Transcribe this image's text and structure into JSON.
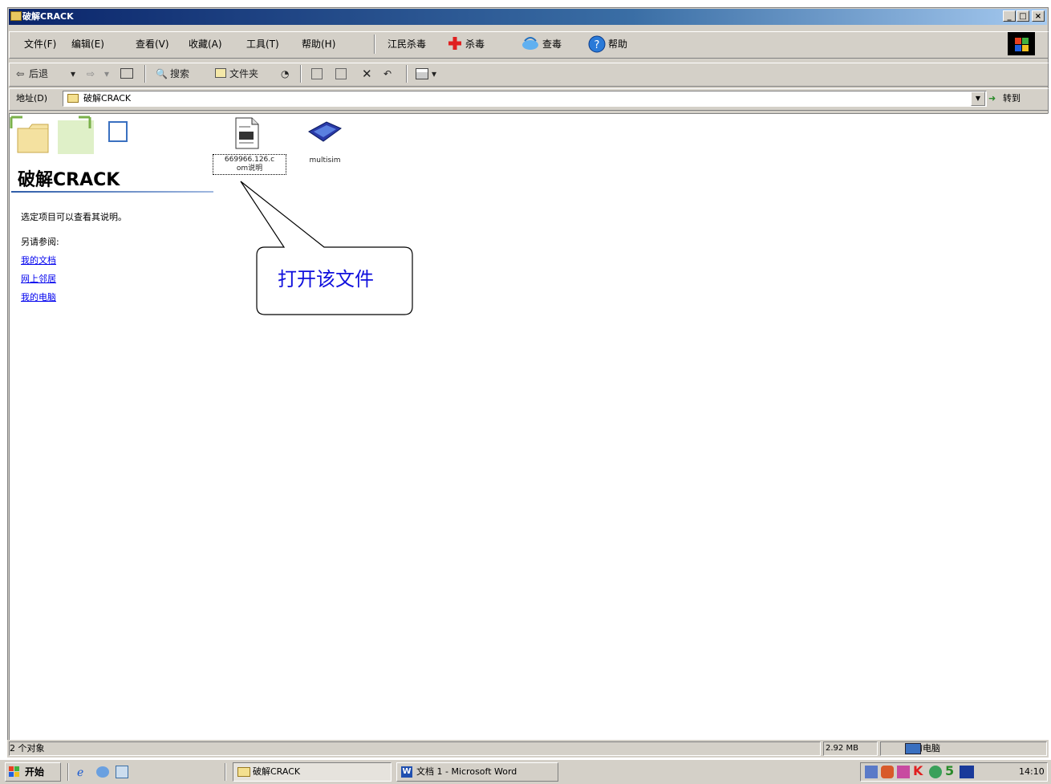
{
  "window": {
    "title": "破解CRACK",
    "controls": [
      "_",
      "□",
      "×"
    ]
  },
  "menu": {
    "items": [
      "文件(F)",
      "编辑(E)",
      "查看(V)",
      "收藏(A)",
      "工具(T)",
      "帮助(H)"
    ],
    "extras": [
      "江民杀毒",
      "杀毒",
      "查毒",
      "帮助"
    ]
  },
  "toolbar": {
    "back": "后退",
    "search": "搜索",
    "folders": "文件夹"
  },
  "address": {
    "label": "地址(D)",
    "value": "破解CRACK",
    "go": "转到"
  },
  "panel": {
    "title": "破解CRACK",
    "description": "选定项目可以查看其说明。",
    "see_also": "另请参阅:",
    "links": [
      "我的文档",
      "网上邻居",
      "我的电脑"
    ]
  },
  "files": [
    {
      "label_line1": "669966.126.c",
      "label_line2": "om说明",
      "icon": "document-icon"
    },
    {
      "label_line1": "multisim",
      "icon": "multisim-app-icon"
    }
  ],
  "callout": {
    "text": "打开该文件"
  },
  "status": {
    "objects": "2 个对象",
    "size": "2.92 MB",
    "zone": "我的电脑"
  },
  "taskbar": {
    "start": "开始",
    "tasks": [
      "破解CRACK",
      "文档 1 - Microsoft Word"
    ],
    "clock": "14:10"
  }
}
